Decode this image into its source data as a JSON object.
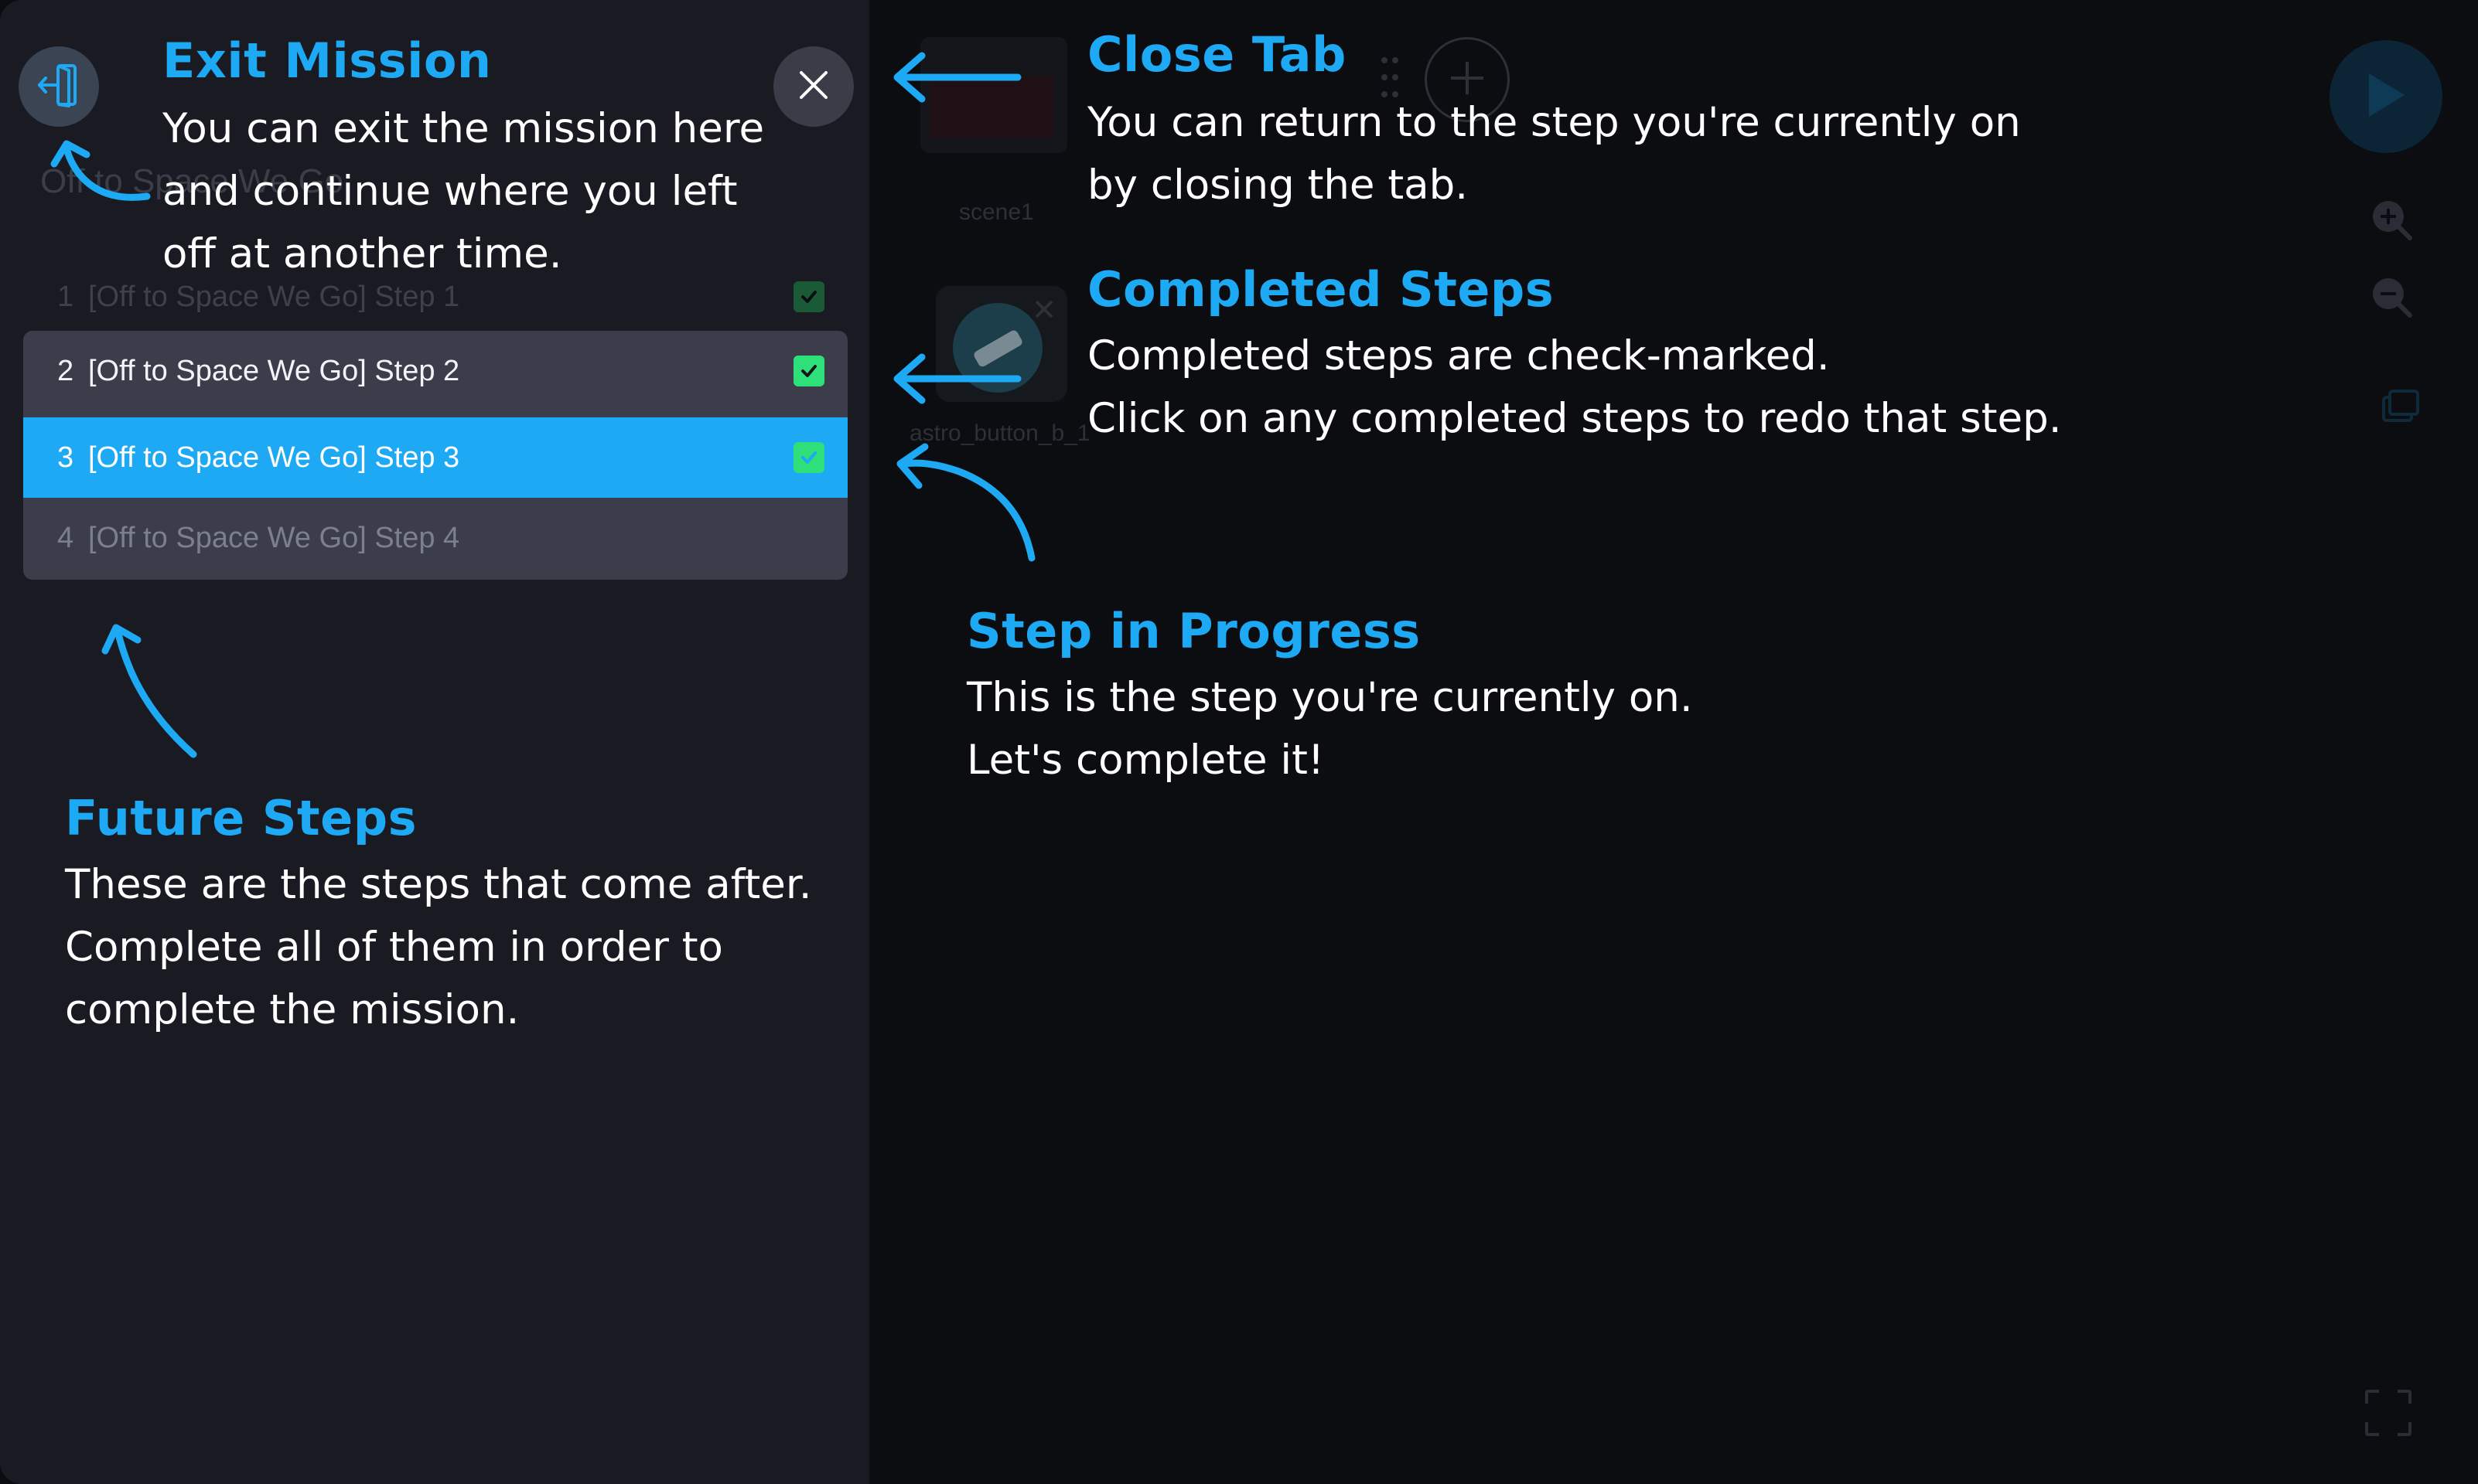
{
  "mission_panel": {
    "title": "Off to Space We Go",
    "steps": [
      {
        "num": "1",
        "label": "[Off to Space We Go] Step 1",
        "status": "completed"
      },
      {
        "num": "2",
        "label": "[Off to Space We Go] Step 2",
        "status": "completed"
      },
      {
        "num": "3",
        "label": "[Off to Space We Go] Step 3",
        "status": "in-progress"
      },
      {
        "num": "4",
        "label": "[Off to Space We Go] Step 4",
        "status": "future"
      }
    ]
  },
  "workspace": {
    "scene_label": "scene1",
    "sprite_label": "astro_button_b_1"
  },
  "annotations": {
    "exit_mission": {
      "title": "Exit Mission",
      "lines": [
        "You can exit the mission here",
        "and continue where you left",
        "off at another time."
      ]
    },
    "close_tab": {
      "title": "Close Tab",
      "lines": [
        "You can return to the step you're currently on",
        "by closing the tab."
      ]
    },
    "completed_steps": {
      "title": "Completed Steps",
      "lines": [
        "Completed steps are check-marked.",
        "Click on any completed steps to redo that step."
      ]
    },
    "step_in_progress": {
      "title": "Step in Progress",
      "lines": [
        "This is the step you're currently on.",
        "Let's complete it!"
      ]
    },
    "future_steps": {
      "title": "Future Steps",
      "lines": [
        "These are the steps that come after.",
        "Complete all of them in order to",
        "complete the mission."
      ]
    }
  },
  "icons": {
    "exit": "exit-door-icon",
    "close": "close-icon",
    "check": "check-icon",
    "add": "plus-icon",
    "play": "play-icon",
    "zoom_in": "zoom-in-icon",
    "zoom_out": "zoom-out-icon",
    "fullscreen": "fullscreen-icon"
  },
  "colors": {
    "accent": "#1ea9f4",
    "check_green": "#2de07a",
    "panel_bg": "#191a22",
    "overlay_bg": "#0c0d11"
  }
}
